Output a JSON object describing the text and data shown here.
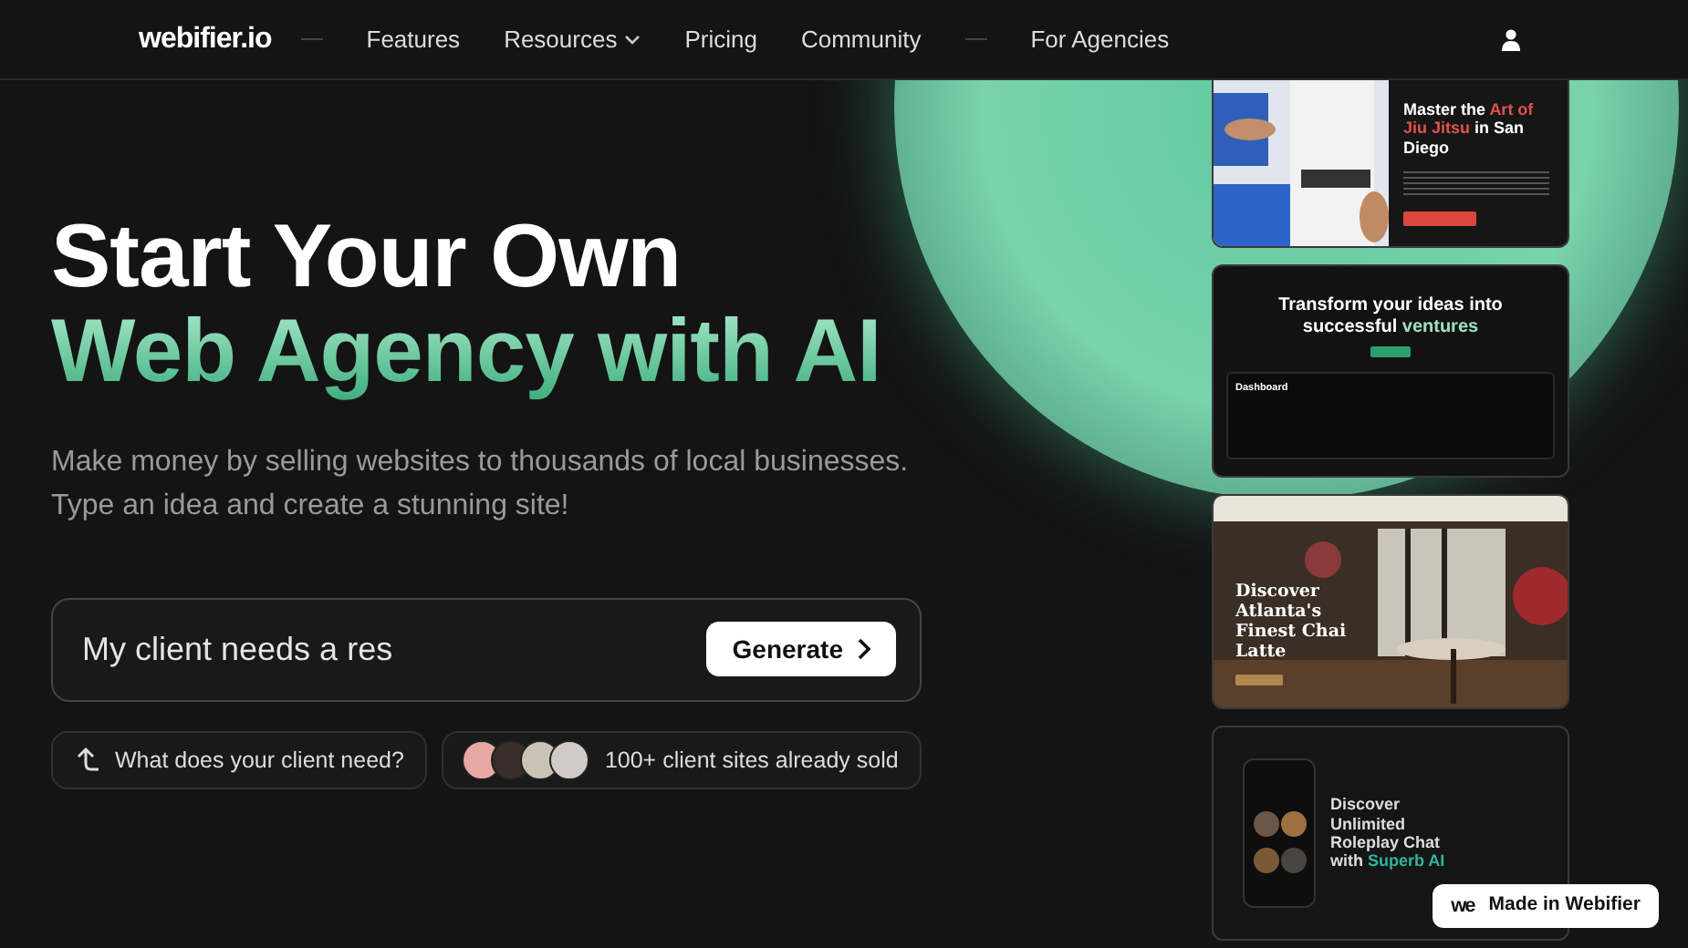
{
  "nav": {
    "logo": "webifier.io",
    "items": [
      {
        "label": "Features",
        "dropdown": false
      },
      {
        "label": "Resources",
        "dropdown": true
      },
      {
        "label": "Pricing",
        "dropdown": false
      },
      {
        "label": "Community",
        "dropdown": false
      },
      {
        "label": "For Agencies",
        "dropdown": false
      }
    ]
  },
  "hero": {
    "title_line_1": "Start Your Own",
    "title_line_2": "Web Agency with AI",
    "subtitle": "Make money by selling websites to thousands of local businesses. Type an idea and create a stunning site!",
    "prompt": {
      "value": "My client needs a res",
      "button": "Generate"
    },
    "hint": "What does your client need?",
    "social_proof": {
      "text": "100+ client sites already sold"
    }
  },
  "previews": [
    {
      "kind": "split",
      "headline": "Master the ",
      "accent": "Art of Jiu Jitsu",
      "tail": " in San Diego"
    },
    {
      "kind": "dashboard",
      "headline": "Transform your ideas into successful ",
      "accent": "ventures",
      "label": "Dashboard"
    },
    {
      "headline": "Discover Atlanta's Finest Chai Latte"
    },
    {
      "kind": "phone",
      "headline": "Discover Unlimited Roleplay Chat with ",
      "accent": "Superb AI"
    }
  ],
  "badge": {
    "logo": "we",
    "text": "Made in Webifier"
  }
}
